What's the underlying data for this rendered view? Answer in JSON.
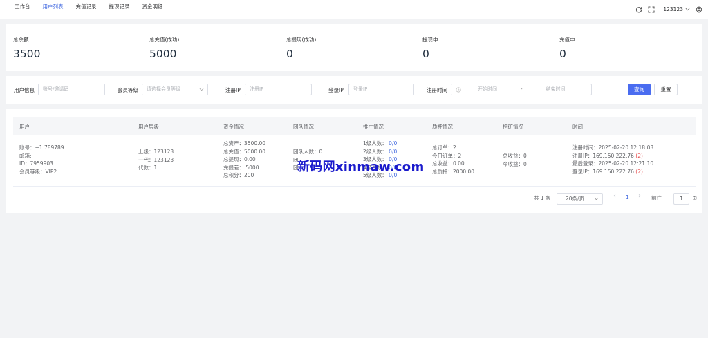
{
  "topbar": {
    "tabs": [
      {
        "label": "工作台"
      },
      {
        "label": "用户列表",
        "active": true
      },
      {
        "label": "充值记录"
      },
      {
        "label": "提现记录"
      },
      {
        "label": "资金明细"
      }
    ],
    "username": "123123"
  },
  "stats": [
    {
      "label": "总余额",
      "value": "3500"
    },
    {
      "label": "总充值(成功)",
      "value": "5000"
    },
    {
      "label": "总提现(成功)",
      "value": "0"
    },
    {
      "label": "提现中",
      "value": "0"
    },
    {
      "label": "充值中",
      "value": "0"
    }
  ],
  "filter": {
    "user_info_label": "用户信息",
    "user_info_placeholder": "账号/邀请码",
    "level_label": "会员等级",
    "level_placeholder": "请选择会员等级",
    "reg_ip_label": "注册IP",
    "reg_ip_placeholder": "注册IP",
    "login_ip_label": "登录IP",
    "login_ip_placeholder": "登录IP",
    "reg_time_label": "注册时间",
    "start_placeholder": "开始时间",
    "range_sep": "-",
    "end_placeholder": "结束时间",
    "search_btn": "查询",
    "reset_btn": "重置"
  },
  "table": {
    "headers": [
      "用户",
      "用户层级",
      "资金情况",
      "团队情况",
      "推广情况",
      "质押情况",
      "挖矿情况",
      "时间"
    ],
    "row": {
      "user": [
        "账号：+1 789789",
        "邮箱:",
        "ID：7959903",
        "会员等级：VIP2"
      ],
      "level": [
        "上级：123123",
        "一代：123123",
        "代数：1"
      ],
      "funds": [
        "总资产：3500.00",
        "总充值：5000.00",
        "总提现：0.00",
        "充提差： 5000",
        "总积分：200"
      ],
      "team": [
        "团队人数：0",
        "团",
        "团"
      ],
      "promo": [
        {
          "label": "1级人数：",
          "value": "0/0"
        },
        {
          "label": "2级人数：",
          "value": "0/0"
        },
        {
          "label": "3级人数：",
          "value": "0/0"
        },
        {
          "label": "4级人数：",
          "value": "0/0"
        },
        {
          "label": "5级人数：",
          "value": "0/0"
        }
      ],
      "pledge": [
        "总订单：2",
        "今日订单：2",
        "总收益：0.00",
        "总质押：2000.00"
      ],
      "mining": [
        "总收益：0",
        "今收益：0"
      ],
      "time": {
        "reg_time": "注册时间：2025-02-20 12:18:03",
        "reg_ip": "注册IP：169.150.222.76",
        "reg_ip_count": "(2)",
        "last_login": "最后登录：2025-02-20 12:21:10",
        "login_ip": "登录IP：169.150.222.76",
        "login_ip_count": "(2)"
      }
    }
  },
  "pagination": {
    "total": "共 1 条",
    "page_size": "20条/页",
    "prev": "‹",
    "current": "1",
    "next": "›",
    "goto_label": "前往",
    "goto_value": "1",
    "page_suffix": "页"
  },
  "watermark": "新码网xinmaw.com"
}
